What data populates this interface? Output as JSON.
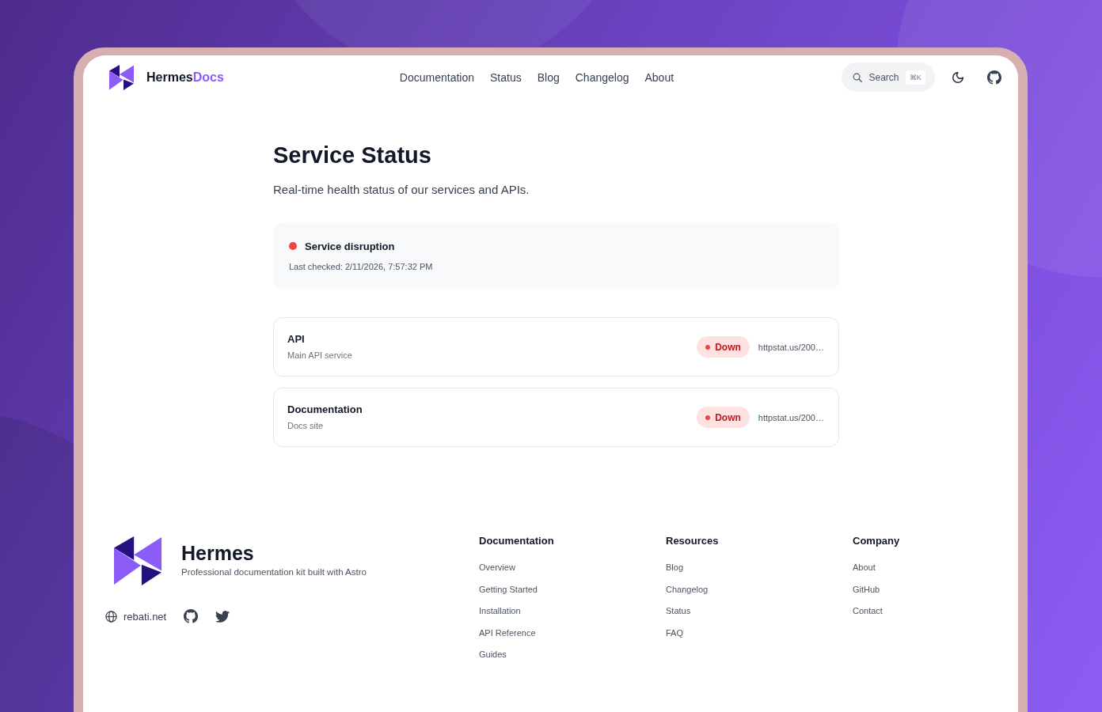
{
  "header": {
    "brand": "Hermes",
    "brand_accent": "Docs",
    "nav": [
      "Documentation",
      "Status",
      "Blog",
      "Changelog",
      "About"
    ],
    "search": {
      "label": "Search",
      "shortcut": "⌘K"
    }
  },
  "page": {
    "title": "Service Status",
    "subtitle": "Real-time health status of our services and APIs."
  },
  "overall": {
    "kind": "disruption",
    "label": "Service disruption",
    "last_checked": "Last checked: 2/11/2026, 7:57:32 PM"
  },
  "services": [
    {
      "name": "API",
      "description": "Main API service",
      "kind": "down",
      "badge": "Down",
      "url": "httpstat.us/200…"
    },
    {
      "name": "Documentation",
      "description": "Docs site",
      "kind": "down",
      "badge": "Down",
      "url": "httpstat.us/200…"
    }
  ],
  "footer": {
    "brand": "Hermes",
    "tagline": "Professional documentation kit built with Astro",
    "social": [
      {
        "kind": "website",
        "label": "rebati.net"
      },
      {
        "kind": "github"
      },
      {
        "kind": "twitter"
      }
    ],
    "columns": [
      {
        "heading": "Documentation",
        "links": [
          "Overview",
          "Getting Started",
          "Installation",
          "API Reference",
          "Guides"
        ]
      },
      {
        "heading": "Resources",
        "links": [
          "Blog",
          "Changelog",
          "Status",
          "FAQ"
        ]
      },
      {
        "heading": "Company",
        "links": [
          "About",
          "GitHub",
          "Contact"
        ]
      }
    ]
  }
}
